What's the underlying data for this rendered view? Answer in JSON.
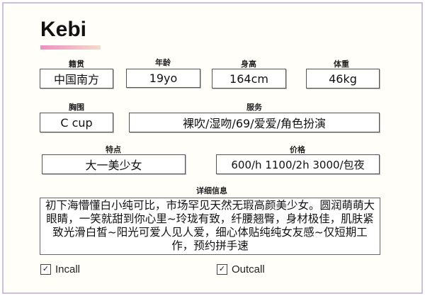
{
  "title": "Kebi",
  "fields": {
    "origin": {
      "label": "籍贯",
      "value": "中国南方"
    },
    "age": {
      "label": "年龄",
      "value": "19yo"
    },
    "height": {
      "label": "身高",
      "value": "164cm"
    },
    "weight": {
      "label": "体重",
      "value": "46kg"
    },
    "bust": {
      "label": "胸围",
      "value": "C cup"
    },
    "services": {
      "label": "服务",
      "value": "裸吹/湿吻/69/爱爱/角色扮演"
    },
    "features": {
      "label": "特点",
      "value": "大一美少女"
    },
    "price": {
      "label": "价格",
      "value": "600/h 1100/2h 3000/包夜"
    }
  },
  "details": {
    "label": "详细信息",
    "value": "初下海懵懂白小纯可比，市场罕见天然无瑕高颜美少女。圆润萌萌大眼睛，一笑就甜到你心里~玲珑有致，纤腰翘臀，身材极佳，肌肤紧致光滑白皙~阳光可爱人见人爱，细心体贴纯纯女友感~仅短期工作，预约拼手速"
  },
  "options": {
    "incall": {
      "label": "Incall",
      "checked": true
    },
    "outcall": {
      "label": "Outcall",
      "checked": true
    }
  }
}
